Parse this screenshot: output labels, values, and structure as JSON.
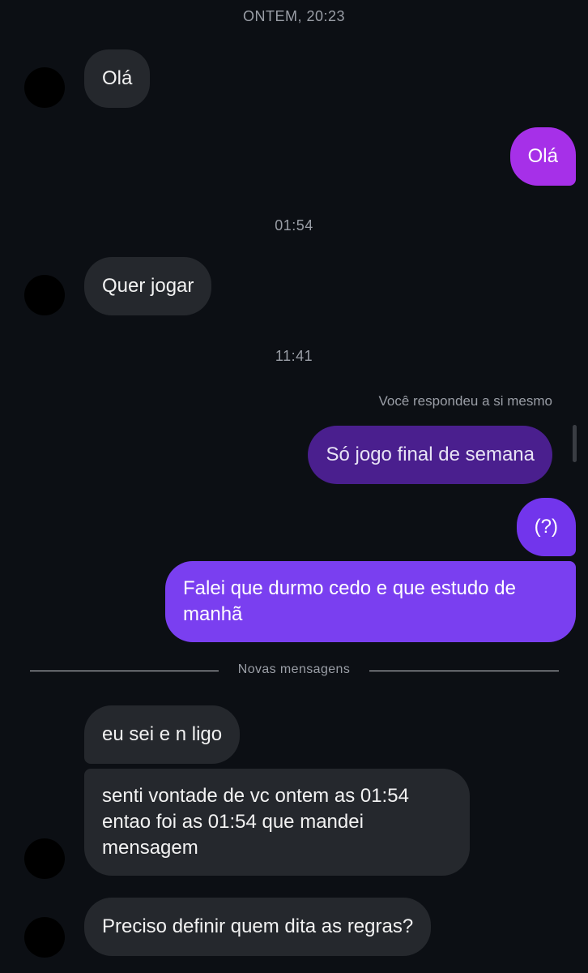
{
  "timestamps": {
    "first": "ONTEM, 20:23",
    "second": "01:54",
    "third": "11:41"
  },
  "messages": {
    "m1": "Olá",
    "m2": "Olá",
    "m3": "Quer jogar",
    "reply_note": "Você respondeu a si mesmo",
    "m4": "Só jogo final de semana",
    "m5": "(?)",
    "m6": "Falei que durmo cedo e que estudo de manhã",
    "m7": "eu sei e n ligo",
    "m8": "senti vontade de vc ontem as 01:54 entao foi as 01:54 que mandei mensagem",
    "m9": "Preciso definir quem dita as regras?"
  },
  "divider": {
    "label": "Novas mensagens"
  },
  "colors": {
    "background": "#0c0f14",
    "incoming_bubble": "#25282d",
    "outgoing_pink": "#a630e8",
    "outgoing_dark_purple": "#4a1f8e",
    "outgoing_purple": "#7a3ff0"
  }
}
